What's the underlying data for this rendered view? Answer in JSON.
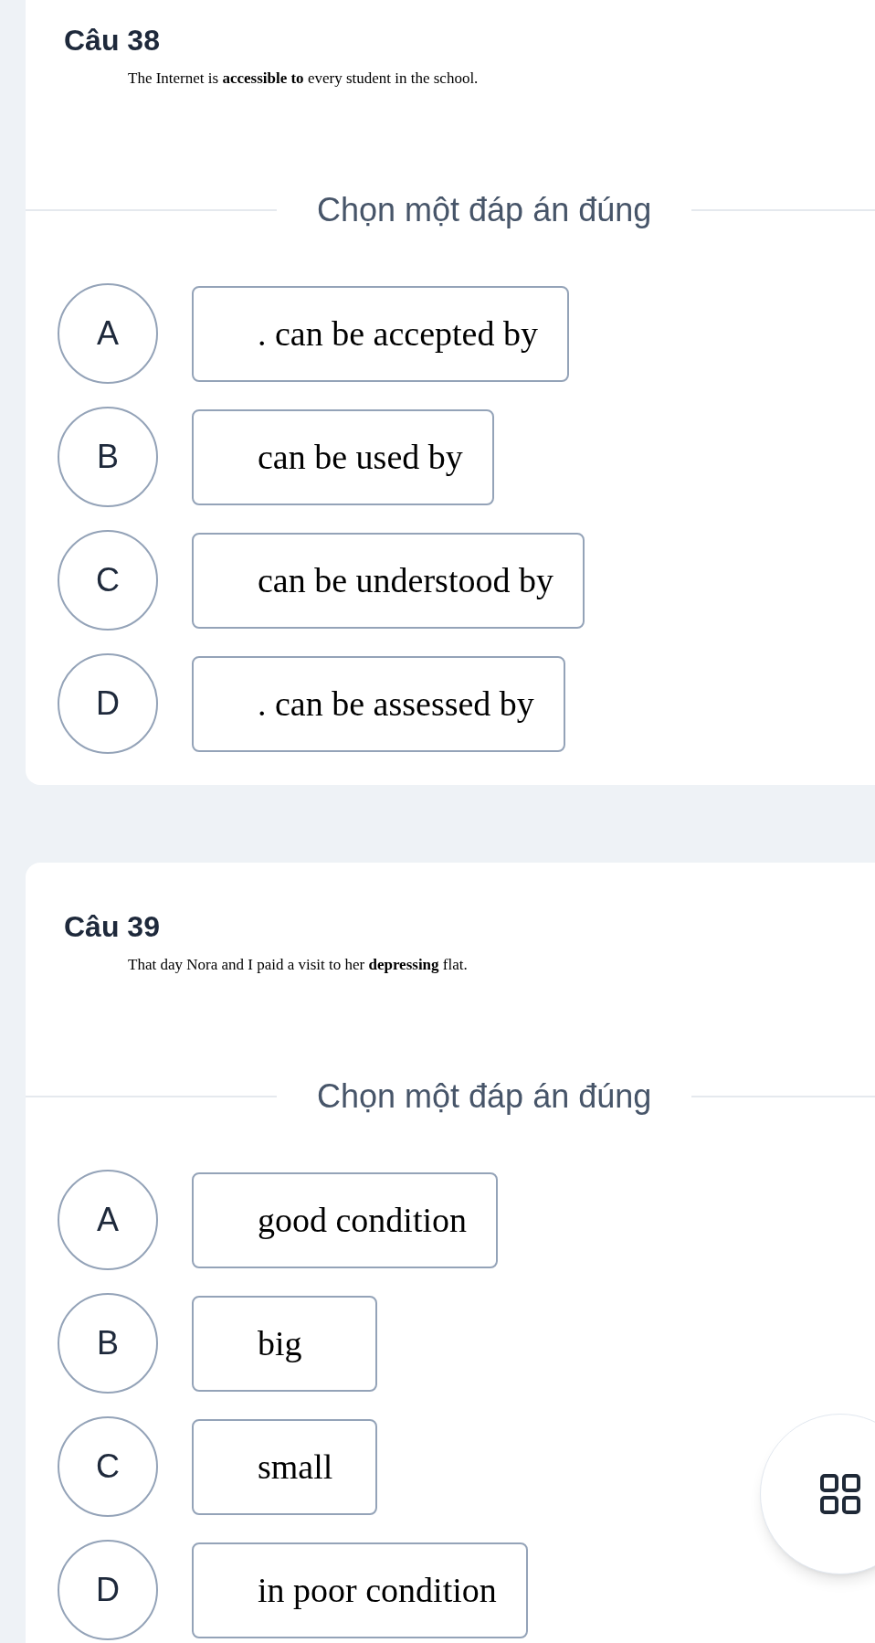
{
  "questions": [
    {
      "title": "Câu 38",
      "prompt": "The Internet is **accessible to** every student in the school.",
      "instruction": "Chọn một đáp án đúng",
      "options": [
        {
          "letter": "A",
          "text": ". can be accepted by"
        },
        {
          "letter": "B",
          "text": "can be used by"
        },
        {
          "letter": "C",
          "text": "can be understood by"
        },
        {
          "letter": "D",
          "text": ". can be assessed by"
        }
      ]
    },
    {
      "title": "Câu 39",
      "prompt": "That day Nora and I paid a visit to her **depressing** flat.",
      "instruction": "Chọn một đáp án đúng",
      "options": [
        {
          "letter": "A",
          "text": "good condition"
        },
        {
          "letter": "B",
          "text": "big"
        },
        {
          "letter": "C",
          "text": "small"
        },
        {
          "letter": "D",
          "text": "in poor condition"
        }
      ]
    }
  ]
}
